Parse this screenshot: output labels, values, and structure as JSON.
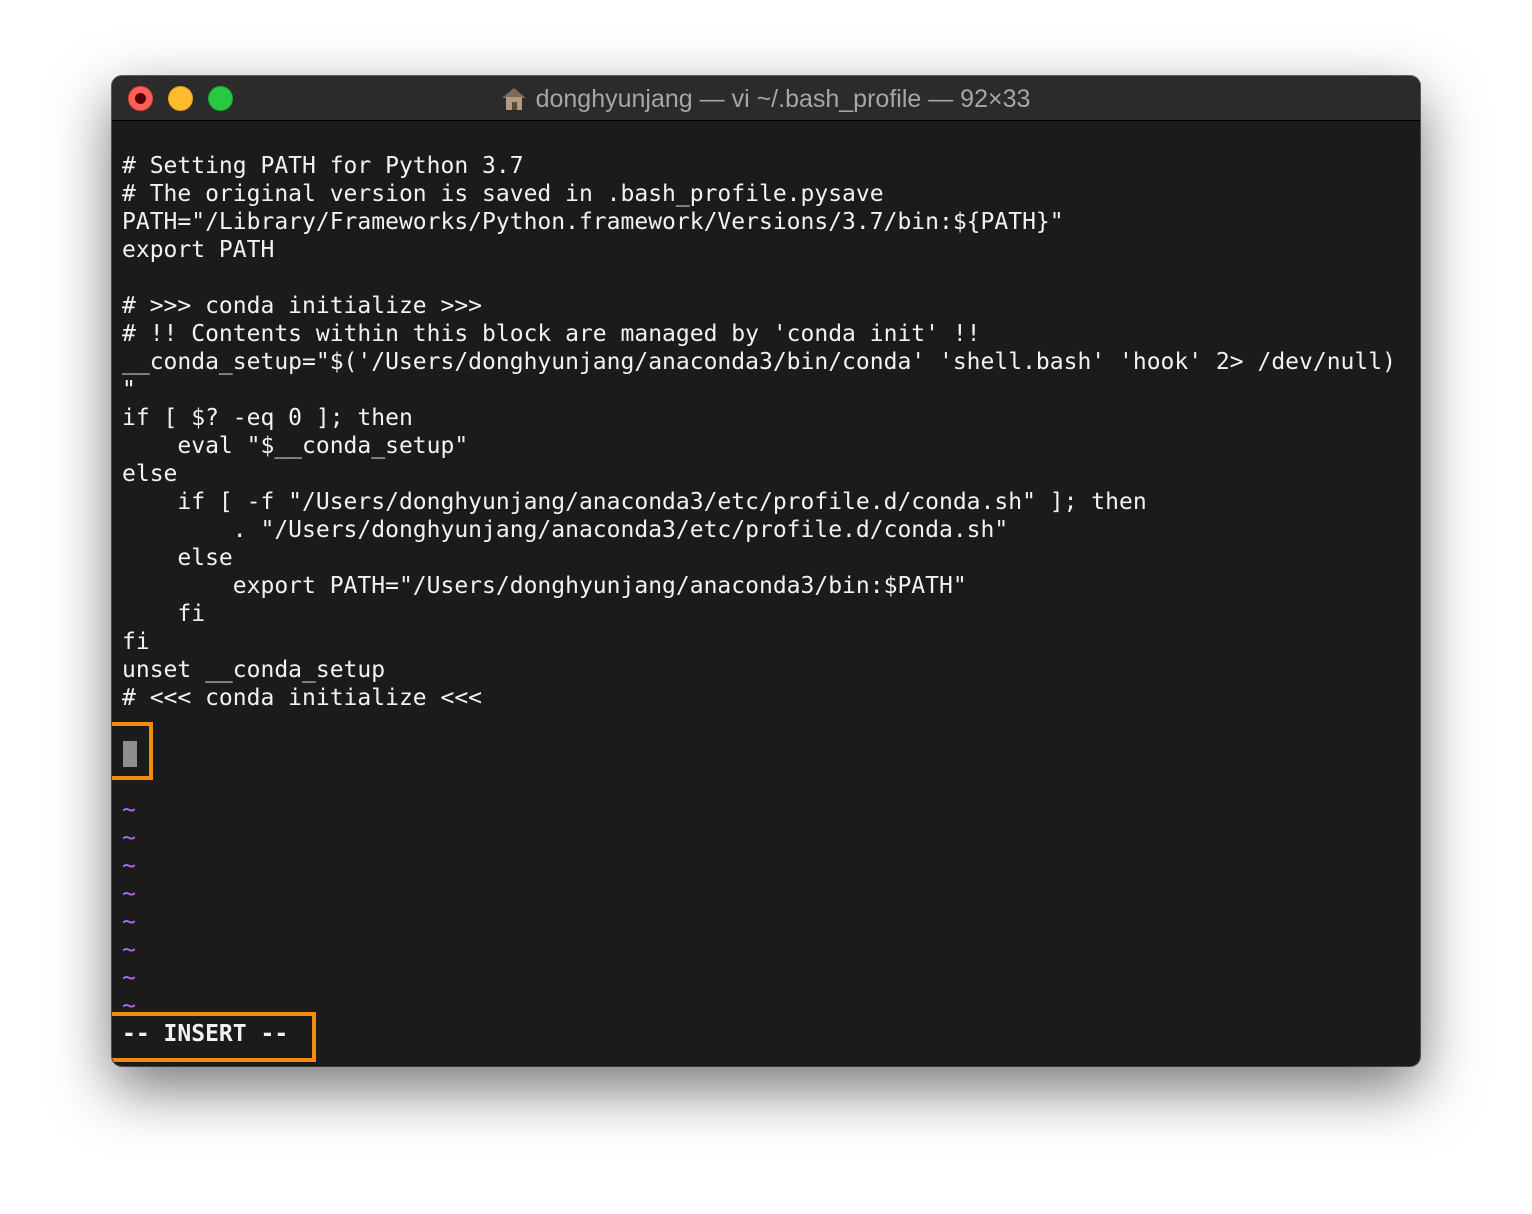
{
  "window": {
    "title": "donghyunjang — vi ~/.bash_profile — 92×33",
    "title_icon": "home-icon"
  },
  "editor": {
    "lines": [
      "# Setting PATH for Python 3.7",
      "# The original version is saved in .bash_profile.pysave",
      "PATH=\"/Library/Frameworks/Python.framework/Versions/3.7/bin:${PATH}\"",
      "export PATH",
      "",
      "# >>> conda initialize >>>",
      "# !! Contents within this block are managed by 'conda init' !!",
      "__conda_setup=\"$('/Users/donghyunjang/anaconda3/bin/conda' 'shell.bash' 'hook' 2> /dev/null)",
      "\"",
      "if [ $? -eq 0 ]; then",
      "    eval \"$__conda_setup\"",
      "else",
      "    if [ -f \"/Users/donghyunjang/anaconda3/etc/profile.d/conda.sh\" ]; then",
      "        . \"/Users/donghyunjang/anaconda3/etc/profile.d/conda.sh\"",
      "    else",
      "        export PATH=\"/Users/donghyunjang/anaconda3/bin:$PATH\"",
      "    fi",
      "fi",
      "unset __conda_setup",
      "# <<< conda initialize <<<"
    ],
    "tildes": [
      "~",
      "~",
      "~",
      "~",
      "~",
      "~",
      "~",
      "~"
    ],
    "mode": "-- INSERT --"
  },
  "colors": {
    "background": "#1b1b1b",
    "text": "#f2f2f2",
    "tilde": "#b26bff",
    "highlight": "#f28c0f"
  }
}
